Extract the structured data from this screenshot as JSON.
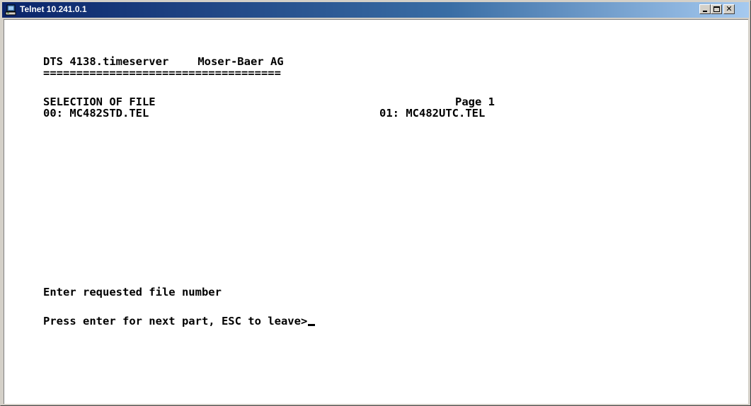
{
  "window": {
    "title": "Telnet 10.241.0.1",
    "icon": "telnet-terminal-icon",
    "controls": {
      "minimize": "minimize-icon",
      "maximize": "maximize-icon",
      "close": "close-icon",
      "close_glyph": "✕"
    }
  },
  "terminal": {
    "header": {
      "product": "DTS 4138.timeserver",
      "company": "Moser-Baer AG"
    },
    "separator": "====================================",
    "section_title": "SELECTION OF FILE",
    "page_label": "Page 1",
    "files": [
      {
        "entry": "00: MC482STD.TEL"
      },
      {
        "entry": "01: MC482UTC.TEL"
      }
    ],
    "prompt_request": "Enter requested file number",
    "prompt_next": "Press enter for next part, ESC to leave>"
  },
  "colors": {
    "titlebar_start": "#0a246a",
    "titlebar_end": "#a6caf0",
    "terminal_bg": "#ffffff",
    "terminal_fg": "#000000"
  }
}
